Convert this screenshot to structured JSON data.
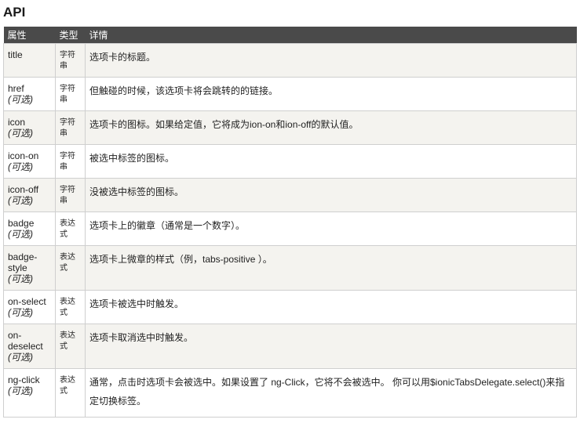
{
  "heading": "API",
  "columns": [
    "属性",
    "类型",
    "详情"
  ],
  "optional_label": "(可选)",
  "rows": [
    {
      "name": "title",
      "optional": false,
      "type": "字符串",
      "desc": "选项卡的标题。"
    },
    {
      "name": "href",
      "optional": true,
      "type": "字符串",
      "desc": "但触碰的时候，该选项卡将会跳转的的链接。"
    },
    {
      "name": "icon",
      "optional": true,
      "type": "字符串",
      "desc": "选项卡的图标。如果给定值，它将成为ion-on和ion-off的默认值。"
    },
    {
      "name": "icon-on",
      "optional": true,
      "type": "字符串",
      "desc": "被选中标签的图标。"
    },
    {
      "name": "icon-off",
      "optional": true,
      "type": "字符串",
      "desc": "没被选中标签的图标。"
    },
    {
      "name": "badge",
      "optional": true,
      "type": "表达式",
      "desc": "选项卡上的徽章（通常是一个数字）。"
    },
    {
      "name": "badge-style",
      "optional": true,
      "type": "表达式",
      "desc": "选项卡上微章的样式（例，tabs-positive ）。"
    },
    {
      "name": "on-select",
      "optional": true,
      "type": "表达式",
      "desc": "选项卡被选中时触发。"
    },
    {
      "name": "on-deselect",
      "optional": true,
      "type": "表达式",
      "desc": "选项卡取消选中时触发。"
    },
    {
      "name": "ng-click",
      "optional": true,
      "type": "表达式",
      "desc": "通常，点击时选项卡会被选中。如果设置了 ng-Click，它将不会被选中。 你可以用$ionicTabsDelegate.select()来指定切换标签。"
    }
  ]
}
